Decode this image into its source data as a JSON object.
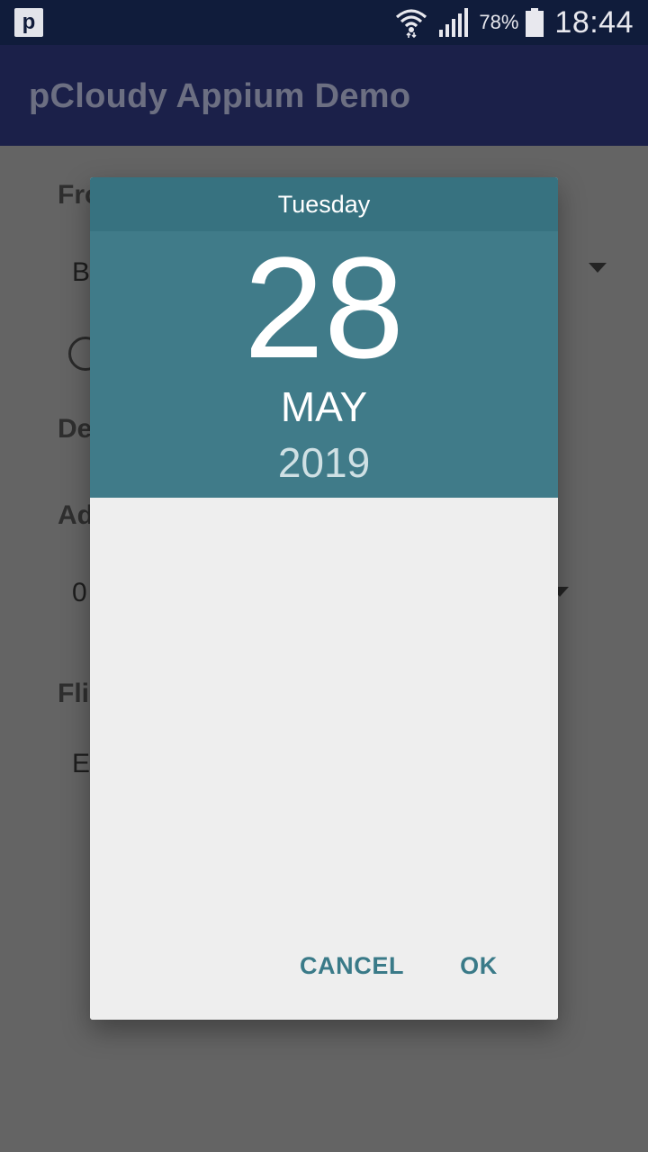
{
  "status_bar": {
    "app_icon_letter": "p",
    "battery_percent": "78%",
    "time": "18:44",
    "icons": [
      "wifi-icon",
      "signal-icon",
      "battery-icon"
    ]
  },
  "app_bar": {
    "title": "pCloudy Appium Demo"
  },
  "background_form": {
    "label_from": "Fro",
    "from_value": "B",
    "label_departure": "De",
    "label_adults": "Ad",
    "adults_value": "0",
    "label_flight": "Fli",
    "flight_value": "E"
  },
  "date_picker": {
    "day_of_week": "Tuesday",
    "day": "28",
    "month": "MAY",
    "year": "2019",
    "cancel_label": "CANCEL",
    "ok_label": "OK"
  },
  "colors": {
    "status_bar": "#101c3b",
    "header_dark": "#377280",
    "header": "#407b89",
    "button_text": "#3a7a88",
    "dialog_bg": "#eeeeee",
    "scrim_bg": "#646464"
  }
}
